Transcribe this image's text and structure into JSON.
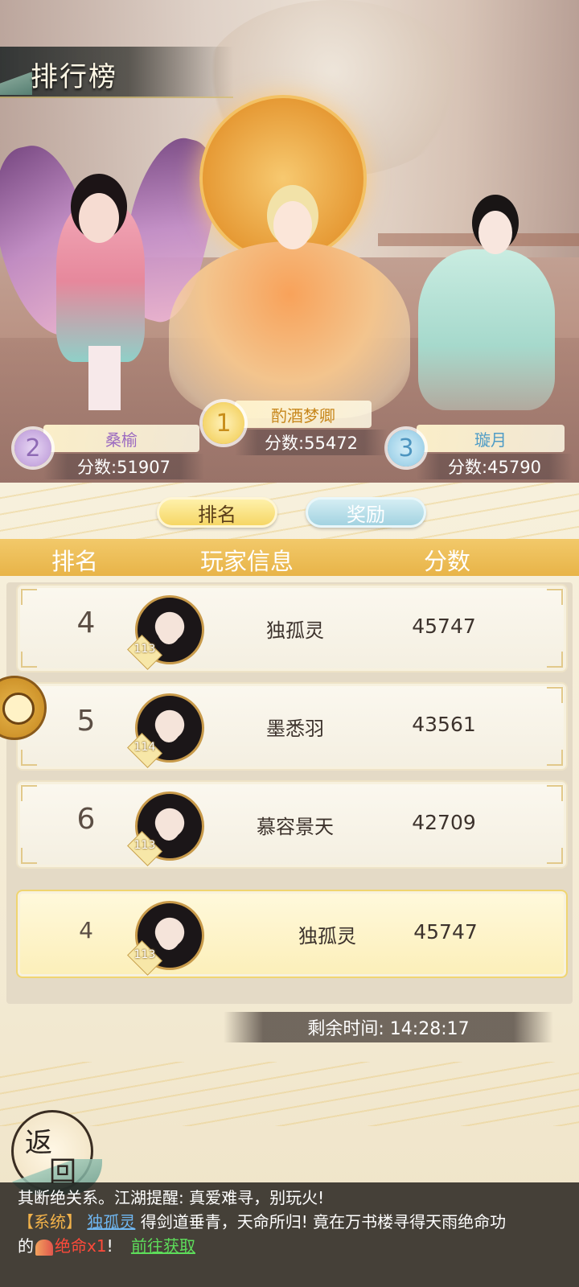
{
  "title": "排行榜",
  "podium": [
    {
      "rank": "1",
      "name": "酌酒梦卿",
      "score": "分数:55472"
    },
    {
      "rank": "2",
      "name": "桑榆",
      "score": "分数:51907"
    },
    {
      "rank": "3",
      "name": "璇月",
      "score": "分数:45790"
    }
  ],
  "tabs": {
    "rank": "排名",
    "reward": "奖励"
  },
  "columns": {
    "rank": "排名",
    "player": "玩家信息",
    "score": "分数"
  },
  "rows": [
    {
      "rank": "4",
      "level": "113",
      "name": "独孤灵",
      "score": "45747"
    },
    {
      "rank": "5",
      "level": "114",
      "name": "墨悉羽",
      "score": "43561"
    },
    {
      "rank": "6",
      "level": "113",
      "name": "慕容景天",
      "score": "42709"
    }
  ],
  "me": {
    "rank": "4",
    "level": "113",
    "name": "独孤灵",
    "score": "45747"
  },
  "timer": "剩余时间: 14:28:17",
  "back": {
    "ch1": "返",
    "ch2": "回"
  },
  "chat": {
    "line1": "其断绝关系。江湖提醒: 真爱难寻，别玩火!",
    "sys_tag": "【系统】",
    "player": "独孤灵",
    "line2_rest": "得剑道垂青，天命所归! 竟在万书楼寻得天雨绝命功",
    "line3_prefix": "的",
    "item": "绝命x1",
    "line3_mid": "!",
    "link": "前往获取"
  },
  "colors": {
    "gold": "#f0c94a",
    "header": "#e8b448",
    "silver": "#b894d6",
    "bronze": "#8cc7e3"
  }
}
